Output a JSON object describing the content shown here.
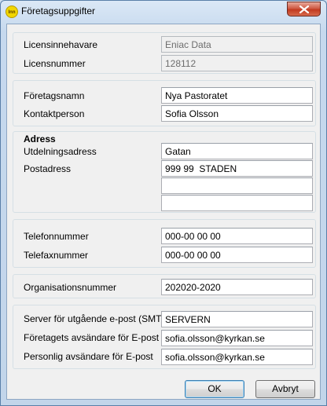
{
  "window": {
    "title": "Företagsuppgifter",
    "app_icon_text": "Inn"
  },
  "license": {
    "holder_label": "Licensinnehavare",
    "holder_value": "Eniac Data",
    "number_label": "Licensnummer",
    "number_value": "128112"
  },
  "company": {
    "name_label": "Företagsnamn",
    "name_value": "Nya Pastoratet",
    "contact_label": "Kontaktperson",
    "contact_value": "Sofia Olsson"
  },
  "address": {
    "heading": "Adress",
    "delivery_label": "Utdelningsadress",
    "delivery_value": "Gatan",
    "postal_label": "Postadress",
    "postal_value": "999 99  STADEN",
    "extra1_value": "",
    "extra2_value": ""
  },
  "phone": {
    "phone_label": "Telefonnummer",
    "phone_value": "000-00 00 00",
    "fax_label": "Telefaxnummer",
    "fax_value": "000-00 00 00"
  },
  "org": {
    "label": "Organisationsnummer",
    "value": "202020-2020"
  },
  "email": {
    "smtp_label": "Server för utgående e-post (SMTP)",
    "smtp_value": "SERVERN",
    "company_sender_label": "Företagets avsändare för E-post",
    "company_sender_value": "sofia.olsson@kyrkan.se",
    "personal_sender_label": "Personlig avsändare för E-post",
    "personal_sender_value": "sofia.olsson@kyrkan.se"
  },
  "buttons": {
    "ok": "OK",
    "cancel": "Avbryt"
  },
  "colors": {
    "titlebar": "#c6d9ee",
    "close": "#c23a20",
    "dialog_bg": "#f0f0f0",
    "default_button_border": "#3c7fb1"
  }
}
